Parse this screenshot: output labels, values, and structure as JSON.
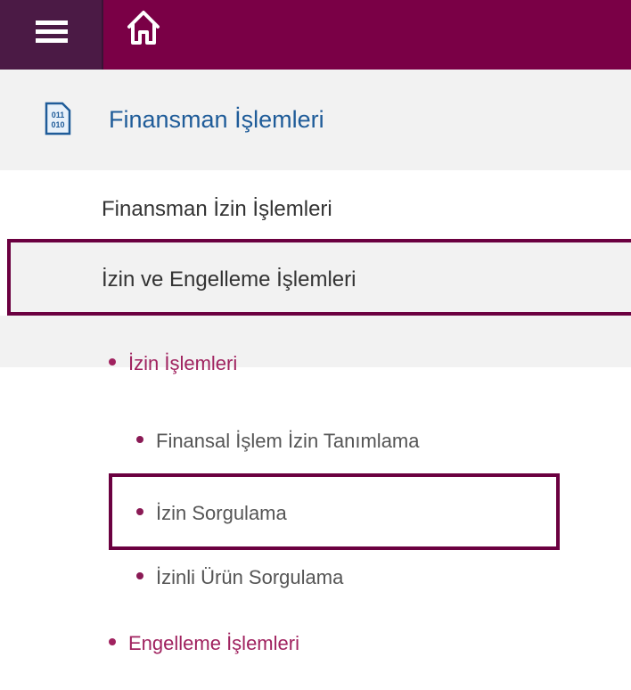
{
  "topbar": {
    "menu_icon": "hamburger-menu-icon",
    "home_icon": "home-icon",
    "colors": {
      "bar": "#7a0046",
      "menu_button": "#4b1a45"
    }
  },
  "section": {
    "icon": "binary-code-icon",
    "icon_text_top": "011",
    "icon_text_bottom": "010",
    "title": "Finansman İşlemleri"
  },
  "menu": {
    "items": [
      {
        "label": "Finansman İzin İşlemleri"
      },
      {
        "label": "İzin ve Engelleme İşlemleri"
      }
    ],
    "sub_items": [
      {
        "label": "İzin İşlemleri"
      },
      {
        "label": "Engelleme İşlemleri"
      }
    ],
    "sub_sub_items": [
      {
        "label": "Finansal İşlem İzin Tanımlama"
      },
      {
        "label": "İzin Sorgulama"
      },
      {
        "label": "İzinli Ürün Sorgulama"
      }
    ]
  },
  "colors": {
    "accent": "#7a0046",
    "title_blue": "#1f5c99",
    "link_pink": "#a0225f"
  }
}
